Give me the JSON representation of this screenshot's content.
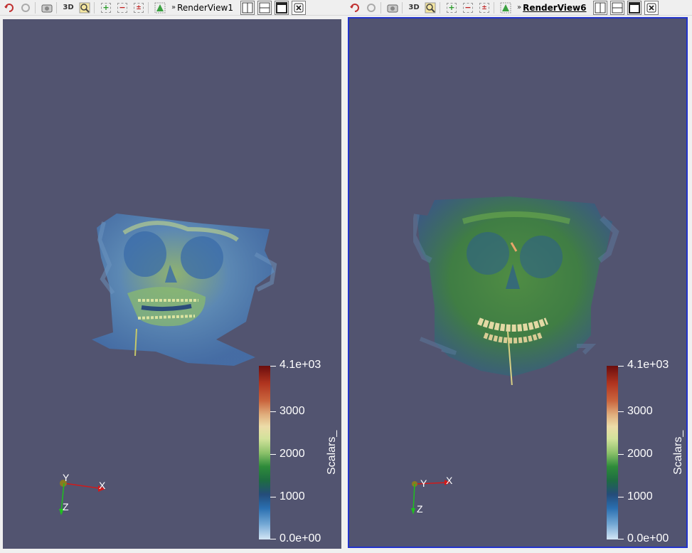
{
  "views": [
    {
      "name": "RenderView1",
      "active": false,
      "legend": {
        "title": "Scalars_",
        "labels": [
          "4.1e+03",
          "3000",
          "2000",
          "1000",
          "0.0e+00"
        ]
      },
      "axes": {
        "x": "X",
        "y": "Y",
        "z": "Z"
      }
    },
    {
      "name": "RenderView6",
      "active": true,
      "legend": {
        "title": "Scalars_",
        "labels": [
          "4.1e+03",
          "3000",
          "2000",
          "1000",
          "0.0e+00"
        ]
      },
      "axes": {
        "x": "X",
        "y": "Y",
        "z": "Z"
      }
    }
  ],
  "toolbar": {
    "btn_3d": "3D",
    "chevron": "»"
  },
  "colors": {
    "background": "#525470",
    "active_border": "#2233cc",
    "axis_x": "#d11a1a",
    "axis_y": "#e0d000",
    "axis_z": "#1fbf1f"
  }
}
